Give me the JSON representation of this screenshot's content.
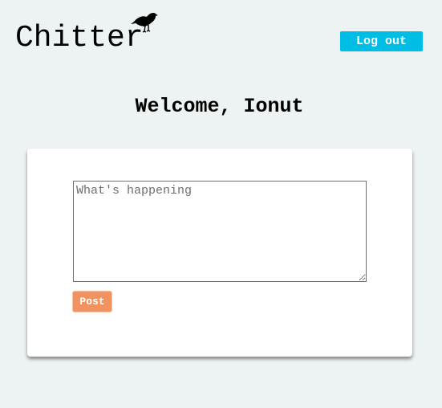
{
  "header": {
    "logo_text": "Chitter",
    "logo_icon": "raven-icon",
    "logout_label": "Log out"
  },
  "main": {
    "welcome_text": "Welcome, Ionut"
  },
  "compose": {
    "value": "",
    "placeholder": "What's happening",
    "post_label": "Post"
  },
  "colors": {
    "page_background": "#edf2f3",
    "logout_button": "#00bde6",
    "post_button": "#f2935f",
    "card_background": "#ffffff"
  }
}
